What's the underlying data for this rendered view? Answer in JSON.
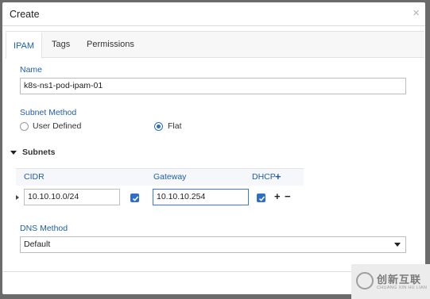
{
  "dialog": {
    "title": "Create",
    "close_glyph": "×"
  },
  "tabs": [
    {
      "label": "IPAM",
      "active": true
    },
    {
      "label": "Tags",
      "active": false
    },
    {
      "label": "Permissions",
      "active": false
    }
  ],
  "name": {
    "label": "Name",
    "value": "k8s-ns1-pod-ipam-01"
  },
  "subnet_method": {
    "label": "Subnet Method",
    "options": [
      {
        "label": "User Defined",
        "selected": false
      },
      {
        "label": "Flat",
        "selected": true
      }
    ]
  },
  "subnets": {
    "section_label": "Subnets",
    "expanded": true,
    "columns": {
      "cidr": "CIDR",
      "gateway": "Gateway",
      "dhcp": "DHCP"
    },
    "add_glyph": "+",
    "remove_glyph": "−",
    "rows": [
      {
        "cidr": "10.10.10.0/24",
        "cidr_checked": true,
        "gateway": "10.10.10.254",
        "dhcp_checked": true
      }
    ]
  },
  "dns_method": {
    "label": "DNS Method",
    "selected": "Default"
  },
  "watermark": {
    "brand": "创新互联",
    "sub": "CHUANG XIN HU LIAN"
  },
  "colors": {
    "accent": "#1f5fa5",
    "checkbox": "#2d6fc8"
  }
}
